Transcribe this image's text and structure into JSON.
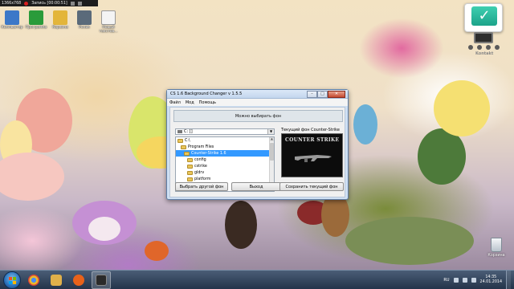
{
  "recording_bar": {
    "resolution": "1366x768",
    "record_text": "Запись [00:00:51]"
  },
  "desktop_icons": [
    {
      "label": "Компьютер",
      "icon": "computer-icon",
      "color": "#3c78c8"
    },
    {
      "label": "Программа",
      "icon": "program-icon",
      "color": "#2a9b3a"
    },
    {
      "label": "Корзина",
      "icon": "folder-icon",
      "color": "#e3b53a"
    },
    {
      "label": "Ролик",
      "icon": "video-icon",
      "color": "#5a6a7a"
    },
    {
      "label": "Новый текстов...",
      "icon": "text-file-icon",
      "color": "#f4f4f4"
    }
  ],
  "window": {
    "title": "CS 1.6 Background Changer v 1.5.5",
    "menu": [
      "Файл",
      "Мод",
      "Помощь"
    ],
    "status": "Можно выбирать фон",
    "drive": "C: []",
    "folders": [
      {
        "label": "C:\\",
        "indent": 0
      },
      {
        "label": "Program Files",
        "indent": 1
      },
      {
        "label": "Counter-Strike 1.6",
        "indent": 2,
        "selected": true
      },
      {
        "label": "config",
        "indent": 3
      },
      {
        "label": "cstrike",
        "indent": 3
      },
      {
        "label": "gldrv",
        "indent": 3
      },
      {
        "label": "platform",
        "indent": 3
      }
    ],
    "preview_label": "Текущий фон Counter-Strike",
    "preview_logo": "COUNTER STRIKE",
    "buttons": {
      "choose": "Выбрать другой фон",
      "exit": "Выход",
      "save": "Сохранить текущий фон"
    }
  },
  "gadget": {
    "brand": "Kontakt"
  },
  "recycle_bin": {
    "label": "Корзина"
  },
  "taskbar": {
    "language": "RU",
    "time": "14:35",
    "date": "24.01.2014",
    "items": [
      {
        "icon": "chrome-icon",
        "color": "#e9b92a"
      },
      {
        "icon": "explorer-icon",
        "color": "#e0b04a"
      },
      {
        "icon": "media-player-icon",
        "color": "#e8621a"
      },
      {
        "icon": "bandicam-icon",
        "color": "#2a2a2a"
      }
    ]
  }
}
